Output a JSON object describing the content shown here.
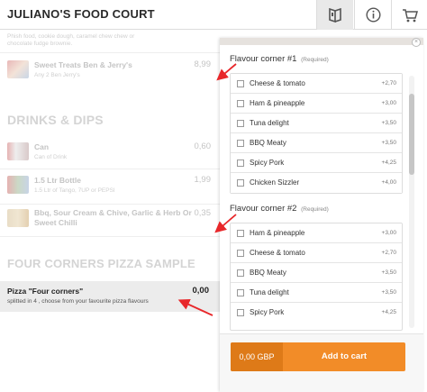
{
  "header": {
    "title": "JULIANO'S FOOD COURT",
    "menu_icon": "menu-book-icon",
    "info_icon": "info-icon",
    "cart_icon": "cart-icon"
  },
  "background_menu": {
    "top_desc": [
      "Phish food, cookie dough, caramel chew chew or",
      "chocolate fudge brownie."
    ],
    "items_top": [
      {
        "name": "Sweet Treats Ben & Jerry's",
        "desc": "Any 2 Ben Jerry's",
        "price": "8,99"
      }
    ],
    "drinks_title": "DRINKS & DIPS",
    "drinks": [
      {
        "name": "Can",
        "desc": "Can of Drink",
        "price": "0,60"
      },
      {
        "name": "1.5 Ltr Bottle",
        "desc": "1.5 Ltr of Tango, 7UP or PEPSI",
        "price": "1,99"
      },
      {
        "name": "Bbq, Sour Cream & Chive, Garlic & Herb Or Sweet Chilli",
        "desc": "",
        "price": "0,35"
      }
    ],
    "pizza_section_title": "FOUR CORNERS PIZZA SAMPLE",
    "pizza": {
      "name": "Pizza \"Four corners\"",
      "desc": "splitted in 4 , choose from your favourite pizza flavours",
      "price": "0,00"
    }
  },
  "panel": {
    "groups": [
      {
        "title": "Flavour corner #1",
        "required": "(Required)",
        "options": [
          {
            "label": "Cheese & tomato",
            "price": "+2,70"
          },
          {
            "label": "Ham & pineapple",
            "price": "+3,00"
          },
          {
            "label": "Tuna delight",
            "price": "+3,50"
          },
          {
            "label": "BBQ Meaty",
            "price": "+3,50"
          },
          {
            "label": "Spicy Pork",
            "price": "+4,25"
          },
          {
            "label": "Chicken Sizzler",
            "price": "+4,00"
          }
        ]
      },
      {
        "title": "Flavour corner #2",
        "required": "(Required)",
        "options": [
          {
            "label": "Ham & pineapple",
            "price": "+3,00"
          },
          {
            "label": "Cheese & tomato",
            "price": "+2,70"
          },
          {
            "label": "BBQ Meaty",
            "price": "+3,50"
          },
          {
            "label": "Tuna delight",
            "price": "+3,50"
          },
          {
            "label": "Spicy Pork",
            "price": "+4,25"
          }
        ]
      }
    ],
    "cart_amount": "0,00 GBP",
    "cart_button_label": "Add to cart"
  },
  "colors": {
    "accent": "#f28c28",
    "accent_dark": "#de7a18",
    "annotation_arrow": "#e8272a"
  }
}
